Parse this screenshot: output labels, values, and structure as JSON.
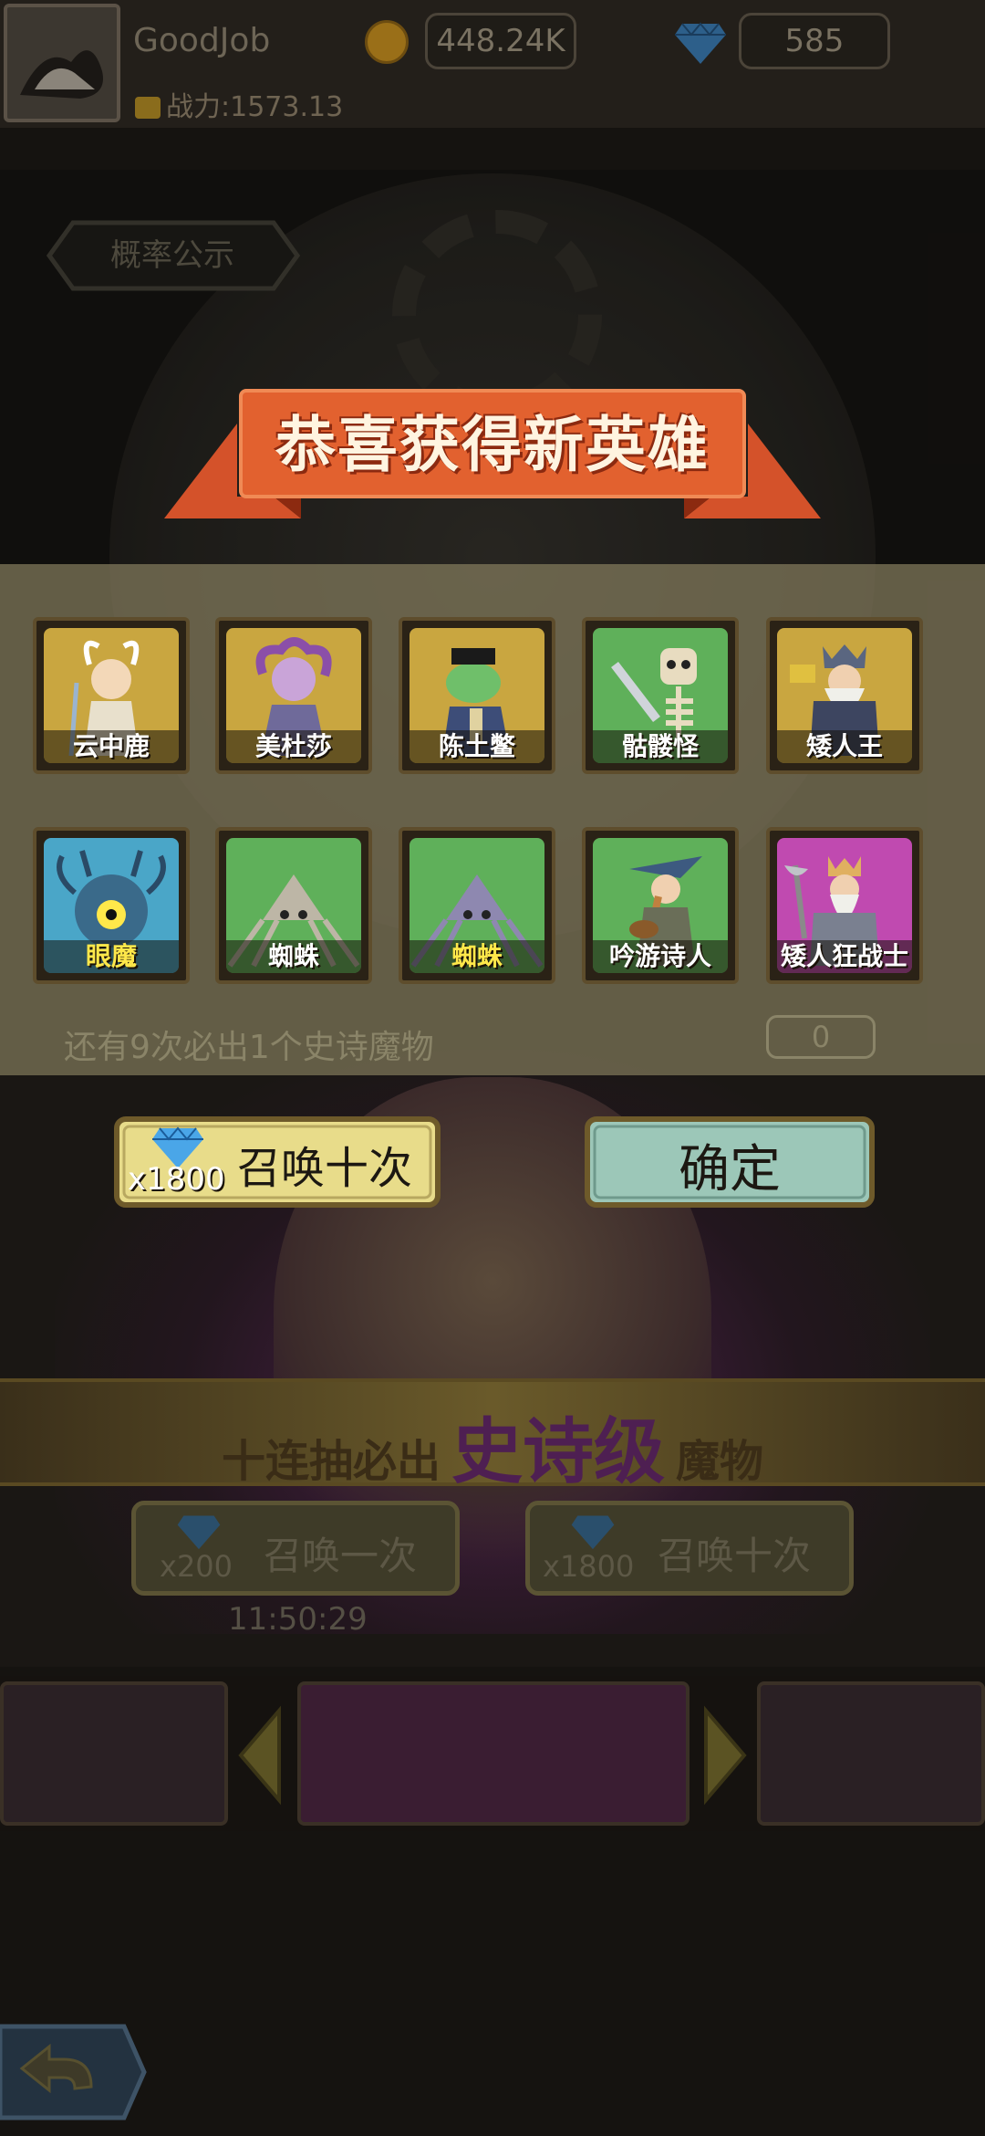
{
  "topbar": {
    "player_name": "GoodJob",
    "power_label": "战力:1573.13",
    "coins": "448.24K",
    "gems": "585"
  },
  "scene": {
    "probability_button": "概率公示",
    "epic_banner": {
      "prefix": "十连抽必出",
      "emphasis": "史诗级",
      "suffix": "魔物"
    },
    "summon_once": {
      "label": "召唤一次",
      "cost": "x200"
    },
    "summon_ten": {
      "label": "召唤十次",
      "cost": "x1800"
    },
    "timer": "11:50:29",
    "pity_text": "还有9次必出1个史诗魔物",
    "pity_count": "0"
  },
  "modal": {
    "title": "恭喜获得新英雄",
    "heroes": [
      {
        "name": "云中鹿",
        "bg": "#c9a640",
        "name_color": "#ffffff",
        "figure": "elf"
      },
      {
        "name": "美杜莎",
        "bg": "#c9a640",
        "name_color": "#ffffff",
        "figure": "medusa"
      },
      {
        "name": "陈土鳖",
        "bg": "#c9a640",
        "name_color": "#ffffff",
        "figure": "turtle"
      },
      {
        "name": "骷髅怪",
        "bg": "#5fb05a",
        "name_color": "#ffffff",
        "figure": "skeleton"
      },
      {
        "name": "矮人王",
        "bg": "#c9a640",
        "name_color": "#ffffff",
        "figure": "dwarf-king"
      },
      {
        "name": "眼魔",
        "bg": "#4aa6c8",
        "name_color": "#ffe84a",
        "figure": "beholder"
      },
      {
        "name": "蜘蛛",
        "bg": "#5fb05a",
        "name_color": "#ffffff",
        "figure": "spider"
      },
      {
        "name": "蜘蛛",
        "bg": "#5fb05a",
        "name_color": "#ffe84a",
        "figure": "spider-purple"
      },
      {
        "name": "吟游诗人",
        "bg": "#5fb05a",
        "name_color": "#ffffff",
        "figure": "bard"
      },
      {
        "name": "矮人狂战士",
        "bg": "#c04ab0",
        "name_color": "#ffffff",
        "figure": "berserker"
      }
    ],
    "summon_ten_button": {
      "label": "召唤十次",
      "cost": "x1800"
    },
    "confirm_button": "确定"
  },
  "colors": {
    "ribbon": "#e05a2a",
    "gold_button": "#e8dc8a",
    "confirm_button": "#9cc7b8",
    "panel": "#746c52"
  }
}
